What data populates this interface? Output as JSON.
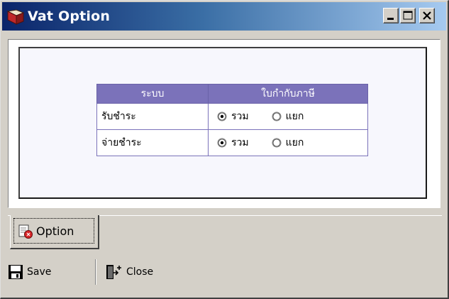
{
  "window": {
    "title": "Vat Option",
    "buttons": [
      "minimize",
      "maximize",
      "close"
    ]
  },
  "table": {
    "headers": [
      "ระบบ",
      "ใบกำกับภาษี"
    ],
    "rows": [
      {
        "label": "รับชำระ",
        "options": [
          "รวม",
          "แยก"
        ],
        "selected": "รวม"
      },
      {
        "label": "จ่ายชำระ",
        "options": [
          "รวม",
          "แยก"
        ],
        "selected": "รวม"
      }
    ]
  },
  "tab": {
    "label": "Option",
    "icon": "option-icon"
  },
  "toolbar": {
    "save_label": "Save",
    "close_label": "Close"
  },
  "colors": {
    "title_start": "#0a246a",
    "title_end": "#a6caf0",
    "header_bg": "#7b72ba",
    "face": "#d4d0c8"
  }
}
